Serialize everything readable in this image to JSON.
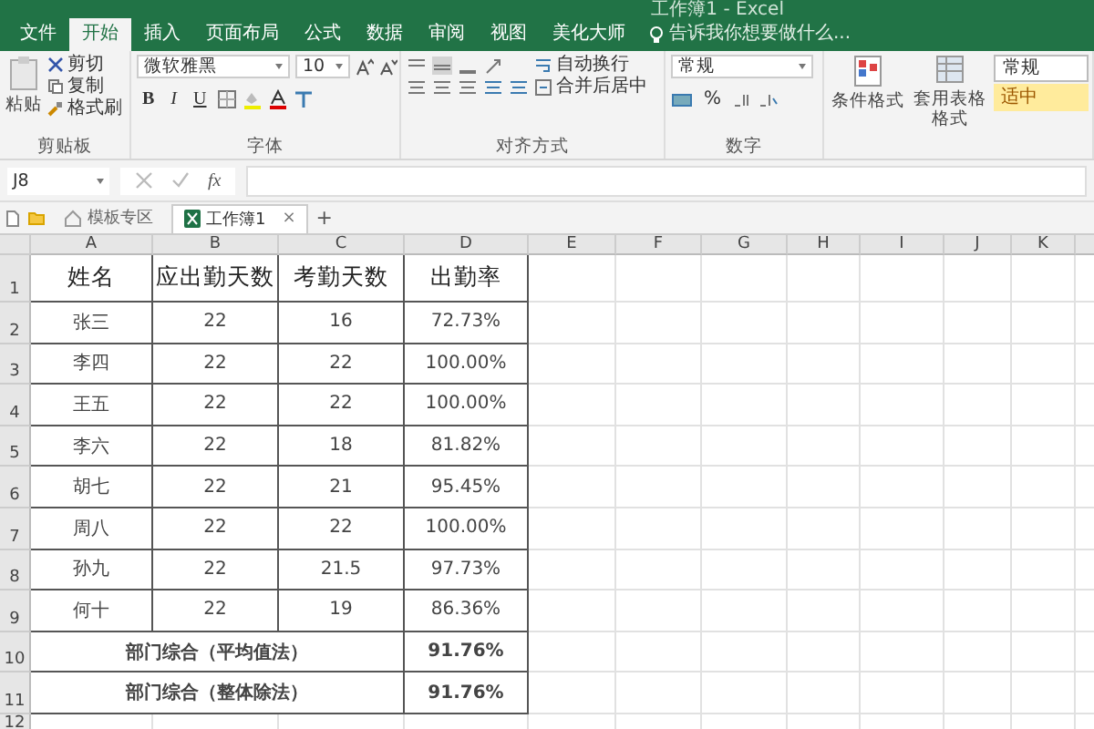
{
  "title_bar": {
    "title": "工作簿1 - Excel"
  },
  "menu_tabs": [
    {
      "label": "文件",
      "selected": false
    },
    {
      "label": "开始",
      "selected": true
    },
    {
      "label": "插入",
      "selected": false
    },
    {
      "label": "页面布局",
      "selected": false
    },
    {
      "label": "公式",
      "selected": false
    },
    {
      "label": "数据",
      "selected": false
    },
    {
      "label": "审阅",
      "selected": false
    },
    {
      "label": "视图",
      "selected": false
    },
    {
      "label": "美化大师",
      "selected": false
    }
  ],
  "tell_me": {
    "placeholder": "告诉我你想要做什么..."
  },
  "ribbon": {
    "clipboard": {
      "label": "剪贴板",
      "paste": "粘贴",
      "cut": "剪切",
      "copy": "复制",
      "format_painter": "格式刷"
    },
    "font": {
      "label": "字体",
      "font_name": "微软雅黑",
      "font_size": "10",
      "bold": "B",
      "italic": "I",
      "underline": "U"
    },
    "alignment": {
      "label": "对齐方式",
      "wrap": "自动换行",
      "merge": "合并后居中"
    },
    "number": {
      "label": "数字",
      "format": "常规",
      "percent": "%"
    },
    "styles": {
      "conditional": "条件格式",
      "table_format": "套用表格格式",
      "style_normal": "常规",
      "style_neutral": "适中"
    }
  },
  "formula_bar": {
    "name_box": "J8",
    "fx": "fx"
  },
  "doc_tabs": [
    {
      "label": "模板专区",
      "selected": false
    },
    {
      "label": "工作簿1",
      "selected": true,
      "close": "×"
    }
  ],
  "new_tab": "+",
  "sheet": {
    "columns": [
      "A",
      "B",
      "C",
      "D",
      "E",
      "F",
      "G",
      "H",
      "I",
      "J",
      "K"
    ],
    "rows": [
      {
        "number": "1",
        "kind": "header",
        "cells": [
          "姓名",
          "应出勤天数",
          "考勤天数",
          "出勤率"
        ]
      },
      {
        "number": "2",
        "kind": "data",
        "cells": [
          "张三",
          "22",
          "16",
          "72.73%"
        ]
      },
      {
        "number": "3",
        "kind": "data",
        "cells": [
          "李四",
          "22",
          "22",
          "100.00%"
        ]
      },
      {
        "number": "4",
        "kind": "data",
        "cells": [
          "王五",
          "22",
          "22",
          "100.00%"
        ]
      },
      {
        "number": "5",
        "kind": "data",
        "cells": [
          "李六",
          "22",
          "18",
          "81.82%"
        ]
      },
      {
        "number": "6",
        "kind": "data",
        "cells": [
          "胡七",
          "22",
          "21",
          "95.45%"
        ]
      },
      {
        "number": "7",
        "kind": "data",
        "cells": [
          "周八",
          "22",
          "22",
          "100.00%"
        ]
      },
      {
        "number": "8",
        "kind": "data",
        "cells": [
          "孙九",
          "22",
          "21.5",
          "97.73%"
        ]
      },
      {
        "number": "9",
        "kind": "data",
        "cells": [
          "何十",
          "22",
          "19",
          "86.36%"
        ]
      },
      {
        "number": "10",
        "kind": "summary",
        "cells": [
          "部门综合（平均值法）",
          "91.76%"
        ]
      },
      {
        "number": "11",
        "kind": "summary",
        "cells": [
          "部门综合（整体除法）",
          "91.76%"
        ]
      },
      {
        "number": "12",
        "kind": "empty",
        "cells": []
      }
    ]
  }
}
